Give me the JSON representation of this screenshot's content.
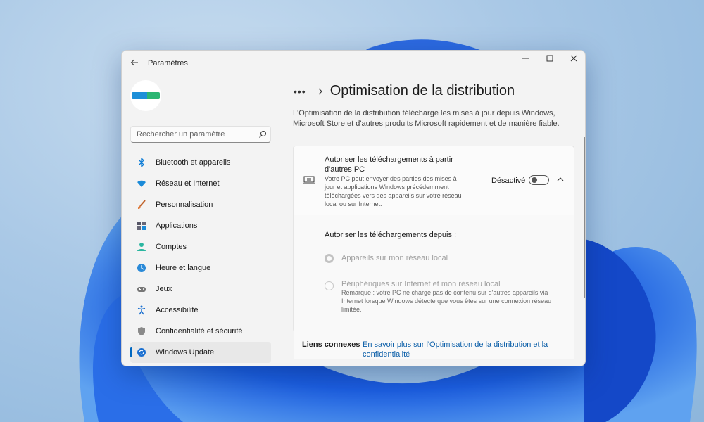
{
  "window": {
    "title": "Paramètres"
  },
  "sidebar": {
    "avatar_text": "",
    "search_placeholder": "Rechercher un paramètre",
    "items": [
      {
        "label": "Bluetooth et appareils",
        "icon": "bluetooth-icon"
      },
      {
        "label": "Réseau et Internet",
        "icon": "wifi-icon"
      },
      {
        "label": "Personnalisation",
        "icon": "brush-icon"
      },
      {
        "label": "Applications",
        "icon": "apps-icon"
      },
      {
        "label": "Comptes",
        "icon": "person-icon"
      },
      {
        "label": "Heure et langue",
        "icon": "globe-clock-icon"
      },
      {
        "label": "Jeux",
        "icon": "gamepad-icon"
      },
      {
        "label": "Accessibilité",
        "icon": "accessibility-icon"
      },
      {
        "label": "Confidentialité et sécurité",
        "icon": "shield-icon"
      },
      {
        "label": "Windows Update",
        "icon": "update-icon",
        "selected": true
      }
    ]
  },
  "main": {
    "breadcrumb_more": "•••",
    "page_title": "Optimisation de la distribution",
    "description": "L'Optimisation de la distribution télécharge les mises à jour depuis Windows, Microsoft Store et d'autres produits Microsoft rapidement et de manière fiable.",
    "card": {
      "title": "Autoriser les téléchargements à partir d'autres PC",
      "subtitle": "Votre PC peut envoyer des parties des mises à jour et applications Windows précédemment téléchargées vers des appareils sur votre réseau local ou sur Internet.",
      "state": "Désactivé",
      "toggle_on": false,
      "from_label": "Autoriser les téléchargements depuis :",
      "options": [
        {
          "label": "Appareils sur mon réseau local",
          "selected": true
        },
        {
          "label": "Périphériques sur Internet et mon réseau local",
          "selected": false
        }
      ],
      "note": "Remarque : votre PC ne charge pas de contenu sur d'autres appareils via Internet lorsque Windows détecte que vous êtes sur une connexion réseau limitée."
    },
    "related": {
      "label": "Liens connexes",
      "link": "En savoir plus sur l'Optimisation de la distribution et la confidentialité"
    }
  },
  "colors": {
    "accent": "#0067c0",
    "link": "#0a5ea8",
    "bloom": "#1a56d6"
  }
}
